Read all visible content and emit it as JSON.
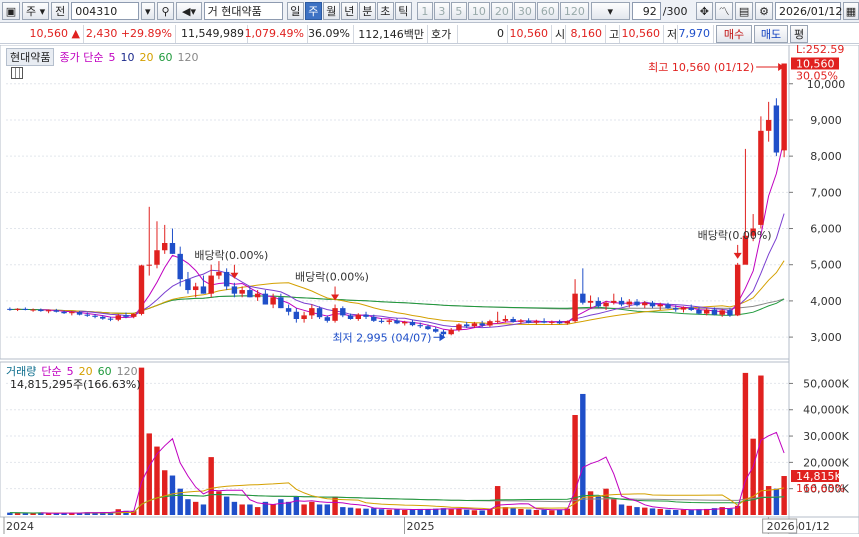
{
  "toolbar": {
    "market": "주",
    "prefix": "전",
    "code": "004310",
    "name_prefix": "거",
    "stock_name": "현대약품",
    "periods": [
      "일",
      "주",
      "월",
      "년",
      "분",
      "초",
      "틱"
    ],
    "selected_period": "주",
    "intervals": [
      "1",
      "3",
      "5",
      "10",
      "20",
      "30",
      "60",
      "120"
    ],
    "count": "92",
    "count_total": "/300",
    "date": "2026/01/12"
  },
  "info": {
    "price": "10,560",
    "change": "2,430",
    "change_pct": "+29.89%",
    "volume": "11,549,989",
    "volume_pct": "1,079.49%",
    "turnover": "36.09%",
    "amount": "112,146백만",
    "hoga_label": "호가",
    "hoga_value": "0",
    "bid": "10,560",
    "open_label": "시",
    "open": "8,160",
    "high_label": "고",
    "high": "10,560",
    "low_label": "저",
    "low": "7,970",
    "buy_label": "매수",
    "sell_label": "매도",
    "eval_label": "평"
  },
  "price_panel": {
    "tag": "현대약품",
    "legend_prefix": "종가 단순",
    "ma": [
      {
        "label": "5",
        "color": "#1c2a8c"
      },
      {
        "label": "10",
        "color": "#7a3fd0"
      },
      {
        "label": "20",
        "color": "#d4a000"
      },
      {
        "label": "60",
        "color": "#1f9a3c"
      },
      {
        "label": "120",
        "color": "#888888"
      }
    ],
    "annotations": {
      "high": "최고 10,560 (01/12)",
      "low": "최저 2,995 (04/07)",
      "dividend_1": "배당락(0.00%)",
      "dividend_2": "배당락(0.00%)",
      "dividend_3": "배당락(0.00%)"
    },
    "current_price_label": "10,560",
    "current_pct_label": "30.05%",
    "top_partial_label": "L:252.59"
  },
  "volume_panel": {
    "label": "거래량",
    "legend_prefix": "단순",
    "ma": [
      {
        "label": "5",
        "color": "#c000c0"
      },
      {
        "label": "20",
        "color": "#d4a000"
      },
      {
        "label": "60",
        "color": "#1f9a3c"
      },
      {
        "label": "120",
        "color": "#888888"
      }
    ],
    "sub_label": "14,815,295주(166.63%)",
    "current_vol_label": "14,815K",
    "current_vol_pct": "166.63%"
  },
  "x_axis": {
    "labels": [
      "2024",
      "2025",
      "2026"
    ],
    "cursor_date": "01/12"
  },
  "chart_data": {
    "type": "candlestick",
    "price_axis": {
      "ticks": [
        3000,
        4000,
        5000,
        6000,
        7000,
        8000,
        9000,
        10000
      ],
      "tick_labels": [
        "3,000",
        "4,000",
        "5,000",
        "6,000",
        "7,000",
        "8,000",
        "9,000",
        "10,000"
      ],
      "range": [
        2450,
        10850
      ]
    },
    "volume_axis": {
      "ticks": [
        10000,
        20000,
        30000,
        40000,
        50000
      ],
      "tick_labels": [
        "10,000K",
        "20,000K",
        "30,000K",
        "40,000K",
        "50,000K"
      ],
      "range": [
        0,
        57000
      ]
    },
    "candles": [
      {
        "o": 3780,
        "h": 3820,
        "l": 3730,
        "c": 3760,
        "v": 900
      },
      {
        "o": 3760,
        "h": 3800,
        "l": 3720,
        "c": 3780,
        "v": 800
      },
      {
        "o": 3780,
        "h": 3820,
        "l": 3740,
        "c": 3750,
        "v": 700
      },
      {
        "o": 3750,
        "h": 3790,
        "l": 3700,
        "c": 3760,
        "v": 700
      },
      {
        "o": 3760,
        "h": 3790,
        "l": 3700,
        "c": 3720,
        "v": 800
      },
      {
        "o": 3720,
        "h": 3760,
        "l": 3660,
        "c": 3740,
        "v": 600
      },
      {
        "o": 3740,
        "h": 3780,
        "l": 3680,
        "c": 3700,
        "v": 700
      },
      {
        "o": 3700,
        "h": 3740,
        "l": 3640,
        "c": 3660,
        "v": 800
      },
      {
        "o": 3660,
        "h": 3720,
        "l": 3600,
        "c": 3690,
        "v": 700
      },
      {
        "o": 3690,
        "h": 3720,
        "l": 3600,
        "c": 3620,
        "v": 900
      },
      {
        "o": 3620,
        "h": 3680,
        "l": 3560,
        "c": 3590,
        "v": 1000
      },
      {
        "o": 3590,
        "h": 3640,
        "l": 3520,
        "c": 3560,
        "v": 900
      },
      {
        "o": 3560,
        "h": 3600,
        "l": 3480,
        "c": 3510,
        "v": 1100
      },
      {
        "o": 3510,
        "h": 3560,
        "l": 3440,
        "c": 3480,
        "v": 1000
      },
      {
        "o": 3480,
        "h": 3640,
        "l": 3440,
        "c": 3600,
        "v": 2200
      },
      {
        "o": 3600,
        "h": 3680,
        "l": 3520,
        "c": 3560,
        "v": 1600
      },
      {
        "o": 3560,
        "h": 3660,
        "l": 3520,
        "c": 3640,
        "v": 1500
      },
      {
        "o": 3640,
        "h": 5000,
        "l": 3600,
        "c": 4980,
        "v": 56000
      },
      {
        "o": 4980,
        "h": 6600,
        "l": 4700,
        "c": 5000,
        "v": 31000
      },
      {
        "o": 5000,
        "h": 6200,
        "l": 4900,
        "c": 5400,
        "v": 26000
      },
      {
        "o": 5400,
        "h": 6100,
        "l": 5300,
        "c": 5600,
        "v": 17000
      },
      {
        "o": 5600,
        "h": 6000,
        "l": 5300,
        "c": 5300,
        "v": 15000
      },
      {
        "o": 5300,
        "h": 5500,
        "l": 4400,
        "c": 4600,
        "v": 10000
      },
      {
        "o": 4600,
        "h": 4800,
        "l": 4200,
        "c": 4300,
        "v": 6000
      },
      {
        "o": 4300,
        "h": 4500,
        "l": 4100,
        "c": 4400,
        "v": 5000
      },
      {
        "o": 4400,
        "h": 4700,
        "l": 4200,
        "c": 4200,
        "v": 4000
      },
      {
        "o": 4200,
        "h": 5000,
        "l": 4100,
        "c": 4700,
        "v": 22000
      },
      {
        "o": 4700,
        "h": 5100,
        "l": 4600,
        "c": 4800,
        "v": 9000
      },
      {
        "o": 4800,
        "h": 4900,
        "l": 4300,
        "c": 4400,
        "v": 7000
      },
      {
        "o": 4400,
        "h": 4500,
        "l": 4100,
        "c": 4200,
        "v": 5000
      },
      {
        "o": 4200,
        "h": 4400,
        "l": 4100,
        "c": 4300,
        "v": 4000
      },
      {
        "o": 4300,
        "h": 4400,
        "l": 4100,
        "c": 4100,
        "v": 4000
      },
      {
        "o": 4100,
        "h": 4300,
        "l": 4000,
        "c": 4200,
        "v": 3000
      },
      {
        "o": 4200,
        "h": 4300,
        "l": 3900,
        "c": 3900,
        "v": 5000
      },
      {
        "o": 3900,
        "h": 4200,
        "l": 3800,
        "c": 4100,
        "v": 4000
      },
      {
        "o": 4100,
        "h": 4200,
        "l": 3800,
        "c": 3800,
        "v": 6000
      },
      {
        "o": 3800,
        "h": 3900,
        "l": 3600,
        "c": 3700,
        "v": 5000
      },
      {
        "o": 3700,
        "h": 3800,
        "l": 3400,
        "c": 3500,
        "v": 7000
      },
      {
        "o": 3500,
        "h": 3700,
        "l": 3400,
        "c": 3600,
        "v": 4000
      },
      {
        "o": 3600,
        "h": 3900,
        "l": 3500,
        "c": 3800,
        "v": 5000
      },
      {
        "o": 3800,
        "h": 3850,
        "l": 3500,
        "c": 3550,
        "v": 4000
      },
      {
        "o": 3550,
        "h": 3600,
        "l": 3400,
        "c": 3450,
        "v": 4000
      },
      {
        "o": 3450,
        "h": 3900,
        "l": 3400,
        "c": 3800,
        "v": 7000
      },
      {
        "o": 3800,
        "h": 3850,
        "l": 3550,
        "c": 3600,
        "v": 3000
      },
      {
        "o": 3600,
        "h": 3650,
        "l": 3480,
        "c": 3500,
        "v": 2800
      },
      {
        "o": 3500,
        "h": 3660,
        "l": 3450,
        "c": 3620,
        "v": 2500
      },
      {
        "o": 3620,
        "h": 3700,
        "l": 3500,
        "c": 3560,
        "v": 2400
      },
      {
        "o": 3560,
        "h": 3620,
        "l": 3420,
        "c": 3450,
        "v": 2600
      },
      {
        "o": 3450,
        "h": 3520,
        "l": 3380,
        "c": 3420,
        "v": 2200
      },
      {
        "o": 3420,
        "h": 3500,
        "l": 3350,
        "c": 3460,
        "v": 2000
      },
      {
        "o": 3460,
        "h": 3520,
        "l": 3360,
        "c": 3380,
        "v": 2100
      },
      {
        "o": 3380,
        "h": 3450,
        "l": 3320,
        "c": 3420,
        "v": 1900
      },
      {
        "o": 3420,
        "h": 3480,
        "l": 3300,
        "c": 3330,
        "v": 2200
      },
      {
        "o": 3330,
        "h": 3400,
        "l": 3250,
        "c": 3300,
        "v": 2300
      },
      {
        "o": 3300,
        "h": 3350,
        "l": 3200,
        "c": 3220,
        "v": 2100
      },
      {
        "o": 3220,
        "h": 3280,
        "l": 3120,
        "c": 3150,
        "v": 2400
      },
      {
        "o": 3150,
        "h": 3200,
        "l": 2995,
        "c": 3080,
        "v": 2600
      },
      {
        "o": 3080,
        "h": 3250,
        "l": 3050,
        "c": 3200,
        "v": 2200
      },
      {
        "o": 3200,
        "h": 3380,
        "l": 3150,
        "c": 3350,
        "v": 2500
      },
      {
        "o": 3350,
        "h": 3420,
        "l": 3250,
        "c": 3300,
        "v": 2000
      },
      {
        "o": 3300,
        "h": 3420,
        "l": 3250,
        "c": 3380,
        "v": 1800
      },
      {
        "o": 3380,
        "h": 3450,
        "l": 3280,
        "c": 3320,
        "v": 1700
      },
      {
        "o": 3320,
        "h": 3480,
        "l": 3280,
        "c": 3440,
        "v": 2300
      },
      {
        "o": 3440,
        "h": 3700,
        "l": 3380,
        "c": 3450,
        "v": 11000
      },
      {
        "o": 3450,
        "h": 3600,
        "l": 3400,
        "c": 3500,
        "v": 3000
      },
      {
        "o": 3500,
        "h": 3560,
        "l": 3400,
        "c": 3420,
        "v": 2600
      },
      {
        "o": 3420,
        "h": 3500,
        "l": 3360,
        "c": 3460,
        "v": 2300
      },
      {
        "o": 3460,
        "h": 3520,
        "l": 3380,
        "c": 3400,
        "v": 2100
      },
      {
        "o": 3400,
        "h": 3480,
        "l": 3350,
        "c": 3440,
        "v": 1900
      },
      {
        "o": 3440,
        "h": 3520,
        "l": 3380,
        "c": 3400,
        "v": 2000
      },
      {
        "o": 3400,
        "h": 3460,
        "l": 3340,
        "c": 3420,
        "v": 1800
      },
      {
        "o": 3420,
        "h": 3480,
        "l": 3360,
        "c": 3380,
        "v": 2100
      },
      {
        "o": 3380,
        "h": 3460,
        "l": 3340,
        "c": 3440,
        "v": 2400
      },
      {
        "o": 3440,
        "h": 4600,
        "l": 3400,
        "c": 4200,
        "v": 38000
      },
      {
        "o": 4200,
        "h": 4900,
        "l": 3900,
        "c": 3950,
        "v": 46000
      },
      {
        "o": 3950,
        "h": 4150,
        "l": 3800,
        "c": 4000,
        "v": 9000
      },
      {
        "o": 4000,
        "h": 4100,
        "l": 3800,
        "c": 3850,
        "v": 7000
      },
      {
        "o": 3850,
        "h": 4000,
        "l": 3750,
        "c": 3950,
        "v": 10000
      },
      {
        "o": 3950,
        "h": 4200,
        "l": 3900,
        "c": 4000,
        "v": 6000
      },
      {
        "o": 4000,
        "h": 4100,
        "l": 3850,
        "c": 3900,
        "v": 4000
      },
      {
        "o": 3900,
        "h": 4050,
        "l": 3820,
        "c": 3980,
        "v": 3500
      },
      {
        "o": 3980,
        "h": 4050,
        "l": 3850,
        "c": 3880,
        "v": 3000
      },
      {
        "o": 3880,
        "h": 4000,
        "l": 3800,
        "c": 3950,
        "v": 2800
      },
      {
        "o": 3950,
        "h": 4000,
        "l": 3800,
        "c": 3850,
        "v": 2500
      },
      {
        "o": 3850,
        "h": 3950,
        "l": 3750,
        "c": 3900,
        "v": 2300
      },
      {
        "o": 3900,
        "h": 3950,
        "l": 3780,
        "c": 3800,
        "v": 2000
      },
      {
        "o": 3800,
        "h": 3880,
        "l": 3700,
        "c": 3760,
        "v": 1900
      },
      {
        "o": 3760,
        "h": 3850,
        "l": 3680,
        "c": 3820,
        "v": 2000
      },
      {
        "o": 3820,
        "h": 3900,
        "l": 3720,
        "c": 3750,
        "v": 1900
      },
      {
        "o": 3750,
        "h": 3820,
        "l": 3620,
        "c": 3650,
        "v": 2200
      },
      {
        "o": 3650,
        "h": 3800,
        "l": 3600,
        "c": 3760,
        "v": 2300
      },
      {
        "o": 3760,
        "h": 3820,
        "l": 3600,
        "c": 3620,
        "v": 2600
      },
      {
        "o": 3620,
        "h": 3780,
        "l": 3560,
        "c": 3740,
        "v": 3000
      },
      {
        "o": 3740,
        "h": 3800,
        "l": 3560,
        "c": 3600,
        "v": 2400
      },
      {
        "o": 3600,
        "h": 5050,
        "l": 3580,
        "c": 5000,
        "v": 3500
      },
      {
        "o": 5000,
        "h": 8200,
        "l": 5700,
        "c": 5800,
        "v": 54000
      },
      {
        "o": 5800,
        "h": 6400,
        "l": 5650,
        "c": 6000,
        "v": 29000
      },
      {
        "o": 6100,
        "h": 9100,
        "l": 6000,
        "c": 8700,
        "v": 53000
      },
      {
        "o": 8700,
        "h": 9500,
        "l": 8400,
        "c": 9000,
        "v": 11000
      },
      {
        "o": 9400,
        "h": 9600,
        "l": 8000,
        "c": 8100,
        "v": 10000
      },
      {
        "o": 8160,
        "h": 10560,
        "l": 7970,
        "c": 10560,
        "v": 14815
      }
    ]
  }
}
